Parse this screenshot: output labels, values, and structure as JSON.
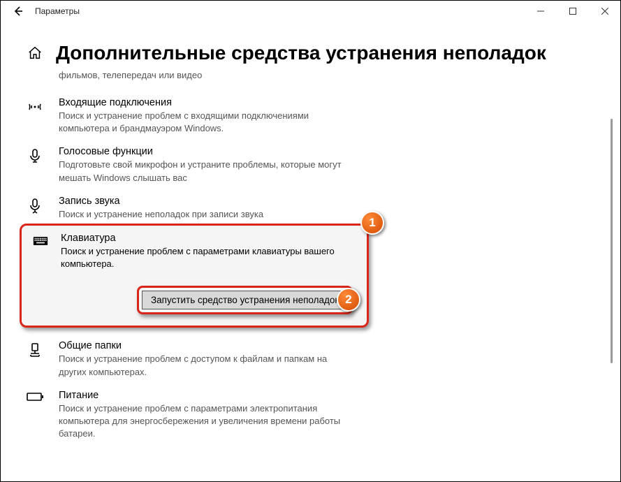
{
  "window": {
    "app_title": "Параметры"
  },
  "header": {
    "page_title": "Дополнительные средства устранения неполадок"
  },
  "partial_top_desc": "фильмов, телепередач или видео",
  "items": {
    "incoming": {
      "title": "Входящие подключения",
      "desc": "Поиск и устранение проблем с входящими подключениями компьютера и брандмауэром Windows."
    },
    "speech": {
      "title": "Голосовые функции",
      "desc": "Подготовьте свой микрофон и устраните проблемы, которые могут мешать Windows слышать вас"
    },
    "recording": {
      "title": "Запись звука",
      "desc": "Поиск и устранение неполадок при записи звука"
    },
    "keyboard": {
      "title": "Клавиатура",
      "desc": "Поиск и устранение проблем с параметрами клавиатуры вашего компьютера.",
      "run_button": "Запустить средство устранения неполадок"
    },
    "shared": {
      "title": "Общие папки",
      "desc": "Поиск и устранение проблем с доступом к файлам и папкам на других компьютерах."
    },
    "power": {
      "title": "Питание",
      "desc": "Поиск и устранение проблем с параметрами электропитания компьютера для энергосбережения и увеличения  времени работы батареи."
    }
  },
  "annotations": {
    "one": "1",
    "two": "2"
  }
}
